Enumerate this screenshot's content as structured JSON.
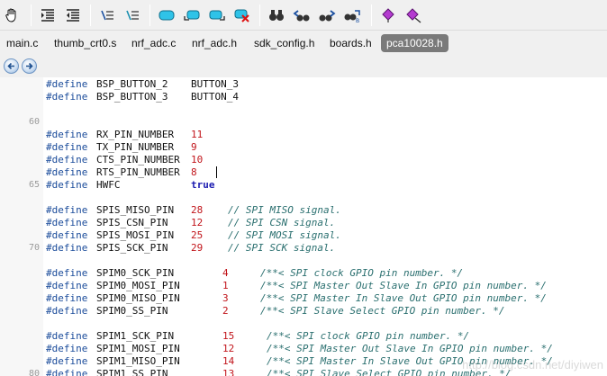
{
  "toolbar": {
    "icons": [
      "hand-icon",
      "indent-icon",
      "outdent-icon",
      "comment-icon",
      "uncomment-icon",
      "bookmark-toggle-icon",
      "bookmark-prev-icon",
      "bookmark-next-icon",
      "bookmark-clear-icon",
      "find-icon",
      "find-prev-icon",
      "find-next-icon",
      "replace-icon",
      "breakpoint-icon",
      "breakpoint-clear-icon"
    ]
  },
  "tabs": [
    {
      "label": "main.c",
      "active": false
    },
    {
      "label": "thumb_crt0.s",
      "active": false
    },
    {
      "label": "nrf_adc.c",
      "active": false
    },
    {
      "label": "nrf_adc.h",
      "active": false
    },
    {
      "label": "sdk_config.h",
      "active": false
    },
    {
      "label": "boards.h",
      "active": false
    },
    {
      "label": "pca10028.h",
      "active": true
    }
  ],
  "nav": {
    "back": "back-icon",
    "forward": "forward-icon"
  },
  "colors": {
    "keyword": "#1a4b9a",
    "number": "#c1141a",
    "comment": "#2a6f6f",
    "true_literal": "#1c1cb0",
    "active_tab": "#7a7a7a"
  },
  "code": [
    {
      "ln": "",
      "kw": "#define",
      "name": "BSP_BUTTON_2",
      "value": "BUTTON_3",
      "vtype": "ident",
      "comment": ""
    },
    {
      "ln": "",
      "kw": "#define",
      "name": "BSP_BUTTON_3",
      "value": "BUTTON_4",
      "vtype": "ident",
      "comment": ""
    },
    {
      "ln": "",
      "kw": "",
      "name": "",
      "value": "",
      "vtype": "",
      "comment": ""
    },
    {
      "ln": "60",
      "kw": "",
      "name": "",
      "value": "",
      "vtype": "",
      "comment": ""
    },
    {
      "ln": "",
      "kw": "#define",
      "name": "RX_PIN_NUMBER",
      "value": "11",
      "vtype": "num",
      "comment": ""
    },
    {
      "ln": "",
      "kw": "#define",
      "name": "TX_PIN_NUMBER",
      "value": "9",
      "vtype": "num",
      "comment": ""
    },
    {
      "ln": "",
      "kw": "#define",
      "name": "CTS_PIN_NUMBER",
      "value": "10",
      "vtype": "num",
      "comment": ""
    },
    {
      "ln": "",
      "kw": "#define",
      "name": "RTS_PIN_NUMBER",
      "value": "8",
      "vtype": "num",
      "comment": ""
    },
    {
      "ln": "65",
      "kw": "#define",
      "name": "HWFC",
      "value": "true",
      "vtype": "true",
      "comment": ""
    },
    {
      "ln": "",
      "kw": "",
      "name": "",
      "value": "",
      "vtype": "",
      "comment": ""
    },
    {
      "ln": "",
      "kw": "#define",
      "name": "SPIS_MISO_PIN",
      "value": "28",
      "vtype": "num",
      "comment": "// SPI MISO signal."
    },
    {
      "ln": "",
      "kw": "#define",
      "name": "SPIS_CSN_PIN",
      "value": "12",
      "vtype": "num",
      "comment": "// SPI CSN signal."
    },
    {
      "ln": "",
      "kw": "#define",
      "name": "SPIS_MOSI_PIN",
      "value": "25",
      "vtype": "num",
      "comment": "// SPI MOSI signal."
    },
    {
      "ln": "70",
      "kw": "#define",
      "name": "SPIS_SCK_PIN",
      "value": "29",
      "vtype": "num",
      "comment": "// SPI SCK signal."
    },
    {
      "ln": "",
      "kw": "",
      "name": "",
      "value": "",
      "vtype": "",
      "comment": ""
    },
    {
      "ln": "",
      "kw": "#define",
      "name": "SPIM0_SCK_PIN",
      "value": "4",
      "vtype": "num",
      "comment": "/**< SPI clock GPIO pin number. */"
    },
    {
      "ln": "",
      "kw": "#define",
      "name": "SPIM0_MOSI_PIN",
      "value": "1",
      "vtype": "num",
      "comment": "/**< SPI Master Out Slave In GPIO pin number. */"
    },
    {
      "ln": "",
      "kw": "#define",
      "name": "SPIM0_MISO_PIN",
      "value": "3",
      "vtype": "num",
      "comment": "/**< SPI Master In Slave Out GPIO pin number. */"
    },
    {
      "ln": "",
      "kw": "#define",
      "name": "SPIM0_SS_PIN",
      "value": "2",
      "vtype": "num",
      "comment": "/**< SPI Slave Select GPIO pin number. */"
    },
    {
      "ln": "",
      "kw": "",
      "name": "",
      "value": "",
      "vtype": "",
      "comment": ""
    },
    {
      "ln": "",
      "kw": "#define",
      "name": "SPIM1_SCK_PIN",
      "value": "15",
      "vtype": "num",
      "comment": "/**< SPI clock GPIO pin number. */"
    },
    {
      "ln": "",
      "kw": "#define",
      "name": "SPIM1_MOSI_PIN",
      "value": "12",
      "vtype": "num",
      "comment": "/**< SPI Master Out Slave In GPIO pin number. */"
    },
    {
      "ln": "",
      "kw": "#define",
      "name": "SPIM1_MISO_PIN",
      "value": "14",
      "vtype": "num",
      "comment": "/**< SPI Master In Slave Out GPIO pin number. */"
    },
    {
      "ln": "80",
      "kw": "#define",
      "name": "SPIM1_SS_PIN",
      "value": "13",
      "vtype": "num",
      "comment": "/**< SPI Slave Select GPIO pin number. */"
    }
  ],
  "watermark": "http://blog.csdn.net/diyiwen"
}
